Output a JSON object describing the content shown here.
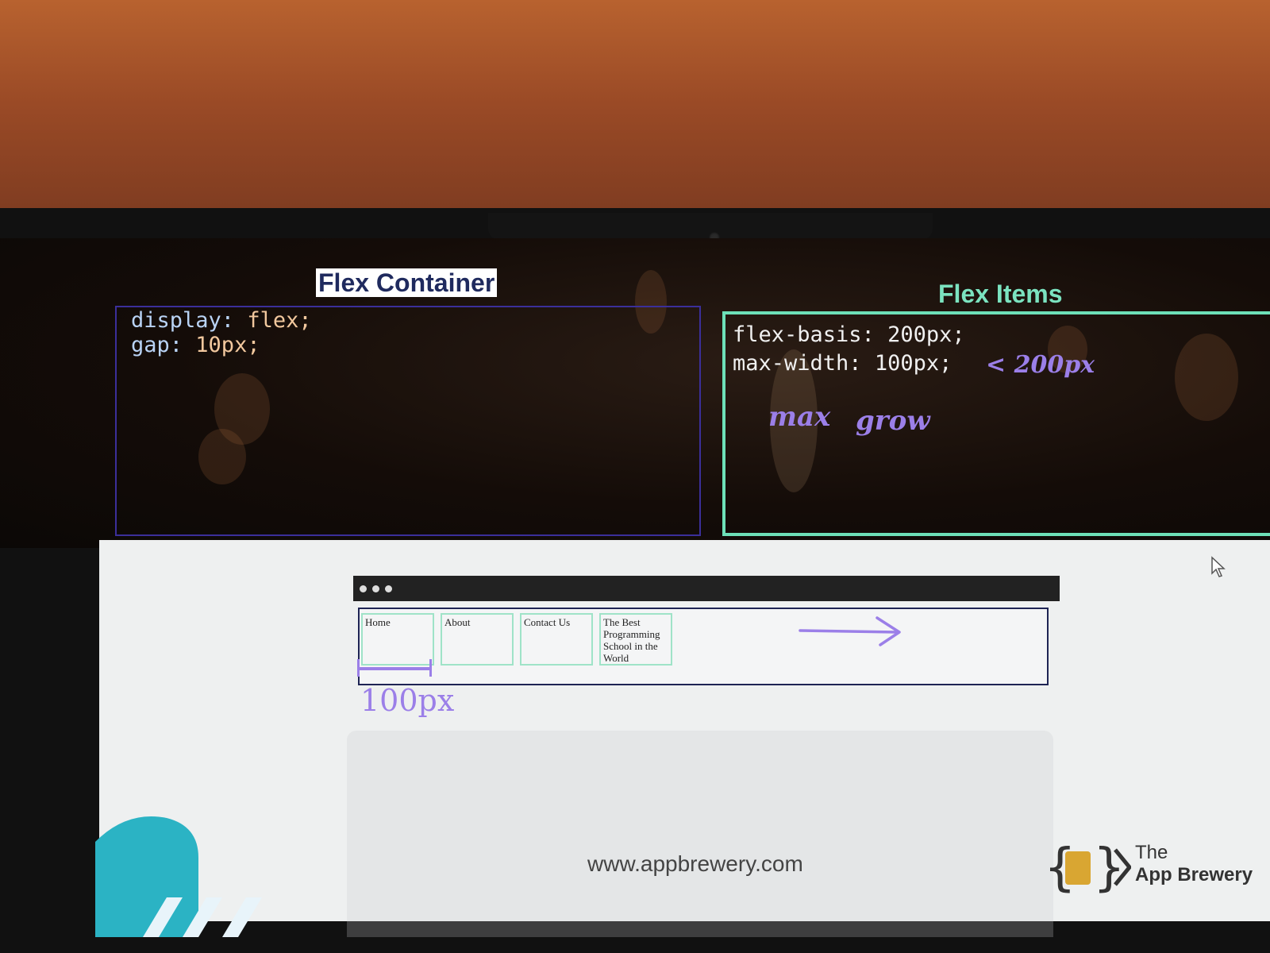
{
  "flex_container": {
    "title": "Flex Container",
    "code_lines": [
      {
        "prop": "display:",
        "value": "flex;"
      },
      {
        "prop": "gap:",
        "value": "10px;"
      }
    ]
  },
  "flex_items": {
    "title": "Flex Items",
    "code_lines": [
      {
        "prop": "flex-basis:",
        "value": "200px;"
      },
      {
        "prop": "max-width:",
        "value": "100px;"
      }
    ],
    "annotations": {
      "less_than": "< 200px",
      "max": "max",
      "grow": "grow"
    }
  },
  "demo": {
    "nav_items": [
      "Home",
      "About",
      "Contact Us",
      "The Best Programming School in the World"
    ],
    "width_annotation": "100px"
  },
  "footer": {
    "url": "www.appbrewery.com",
    "brand_line1": "The",
    "brand_line2": "App Brewery"
  },
  "colors": {
    "container_border": "#3b2f9a",
    "items_border": "#6de0b8",
    "annotation": "#9b7fe8"
  }
}
